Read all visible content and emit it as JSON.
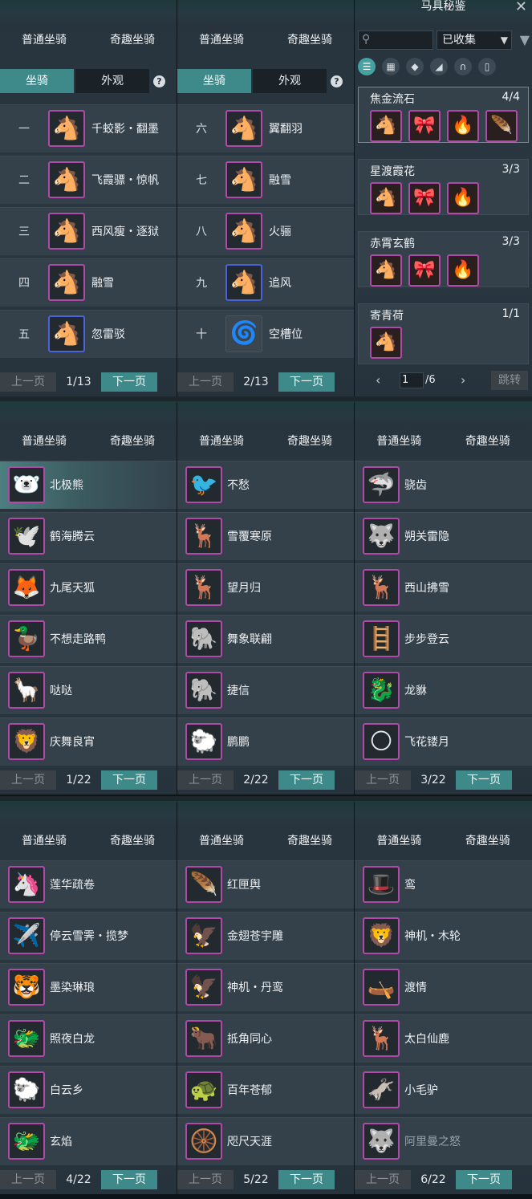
{
  "common": {
    "cat_normal": "普通坐骑",
    "cat_fun": "奇趣坐骑",
    "sub_mount": "坐骑",
    "sub_look": "外观",
    "help": "?",
    "prev": "上一页",
    "next": "下一页"
  },
  "p1": {
    "page": "1/13",
    "rows": [
      {
        "num": "一",
        "name": "千蛟影・翻墨",
        "emoji": "🐴"
      },
      {
        "num": "二",
        "name": "飞霞骠・惊帆",
        "emoji": "🐴"
      },
      {
        "num": "三",
        "name": "西风瘦・逐狱",
        "emoji": "🐴"
      },
      {
        "num": "四",
        "name": "融雪",
        "emoji": "🐴"
      },
      {
        "num": "五",
        "name": "忽雷驳",
        "emoji": "🐴"
      }
    ]
  },
  "p2": {
    "page": "2/13",
    "rows": [
      {
        "num": "六",
        "name": "翼翻羽",
        "emoji": "🐴"
      },
      {
        "num": "七",
        "name": "融雪",
        "emoji": "🐴"
      },
      {
        "num": "八",
        "name": "火骊",
        "emoji": "🐴"
      },
      {
        "num": "九",
        "name": "追风",
        "emoji": "🐴"
      },
      {
        "num": "十",
        "name": "空槽位",
        "emoji": "🌀"
      }
    ]
  },
  "gear": {
    "title": "马具秘鉴",
    "filter": "已收集",
    "page_input": "1",
    "page_total": "/6",
    "jump": "跳转",
    "groups": [
      {
        "name": "焦金流石",
        "count": "4/4",
        "n": 4
      },
      {
        "name": "星渡霞花",
        "count": "3/3",
        "n": 3
      },
      {
        "name": "赤霄玄鹤",
        "count": "3/3",
        "n": 3
      },
      {
        "name": "寄青荷",
        "count": "1/1",
        "n": 1
      }
    ]
  },
  "r1": [
    {
      "page": "1/22",
      "items": [
        {
          "name": "北极熊",
          "e": "🐻‍❄️"
        },
        {
          "name": "鹤海腾云",
          "e": "🕊️"
        },
        {
          "name": "九尾天狐",
          "e": "🦊"
        },
        {
          "name": "不想走路鸭",
          "e": "🦆"
        },
        {
          "name": "哒哒",
          "e": "🦙"
        },
        {
          "name": "庆舞良宵",
          "e": "🦁"
        }
      ]
    },
    {
      "page": "2/22",
      "items": [
        {
          "name": "不愁",
          "e": "🐦"
        },
        {
          "name": "雪覆寒原",
          "e": "🦌"
        },
        {
          "name": "望月归",
          "e": "🦌"
        },
        {
          "name": "舞象联翩",
          "e": "🐘"
        },
        {
          "name": "捷信",
          "e": "🐘"
        },
        {
          "name": "鹏鹏",
          "e": "🐑"
        }
      ]
    },
    {
      "page": "3/22",
      "items": [
        {
          "name": "骁齿",
          "e": "🦈"
        },
        {
          "name": "朔关雷隐",
          "e": "🐺"
        },
        {
          "name": "西山拂雪",
          "e": "🦌"
        },
        {
          "name": "步步登云",
          "e": "🪜"
        },
        {
          "name": "龙貅",
          "e": "🐉"
        },
        {
          "name": "飞花镂月",
          "e": "🌕"
        }
      ]
    }
  ],
  "r2": [
    {
      "page": "4/22",
      "items": [
        {
          "name": "莲华疏卷",
          "e": "🦄"
        },
        {
          "name": "停云雪霁・揽梦",
          "e": "✈️"
        },
        {
          "name": "墨染琳琅",
          "e": "🐯"
        },
        {
          "name": "照夜白龙",
          "e": "🐲"
        },
        {
          "name": "白云乡",
          "e": "🐑"
        },
        {
          "name": "玄焰",
          "e": "🐲"
        }
      ]
    },
    {
      "page": "5/22",
      "items": [
        {
          "name": "红匣舆",
          "e": "🪶"
        },
        {
          "name": "金翅苍宇雕",
          "e": "🦅"
        },
        {
          "name": "神机・丹鸾",
          "e": "🦅"
        },
        {
          "name": "抵角同心",
          "e": "🐂"
        },
        {
          "name": "百年苍郁",
          "e": "🐢"
        },
        {
          "name": "咫尺天涯",
          "e": "🛞"
        }
      ]
    },
    {
      "page": "6/22",
      "items": [
        {
          "name": "鸾",
          "e": "🎩"
        },
        {
          "name": "神机・木轮",
          "e": "🦁"
        },
        {
          "name": "渡情",
          "e": "🛶"
        },
        {
          "name": "太白仙鹿",
          "e": "🦌"
        },
        {
          "name": "小毛驴",
          "e": "🫏"
        },
        {
          "name": "阿里曼之怒",
          "e": "🐺"
        }
      ]
    }
  ]
}
